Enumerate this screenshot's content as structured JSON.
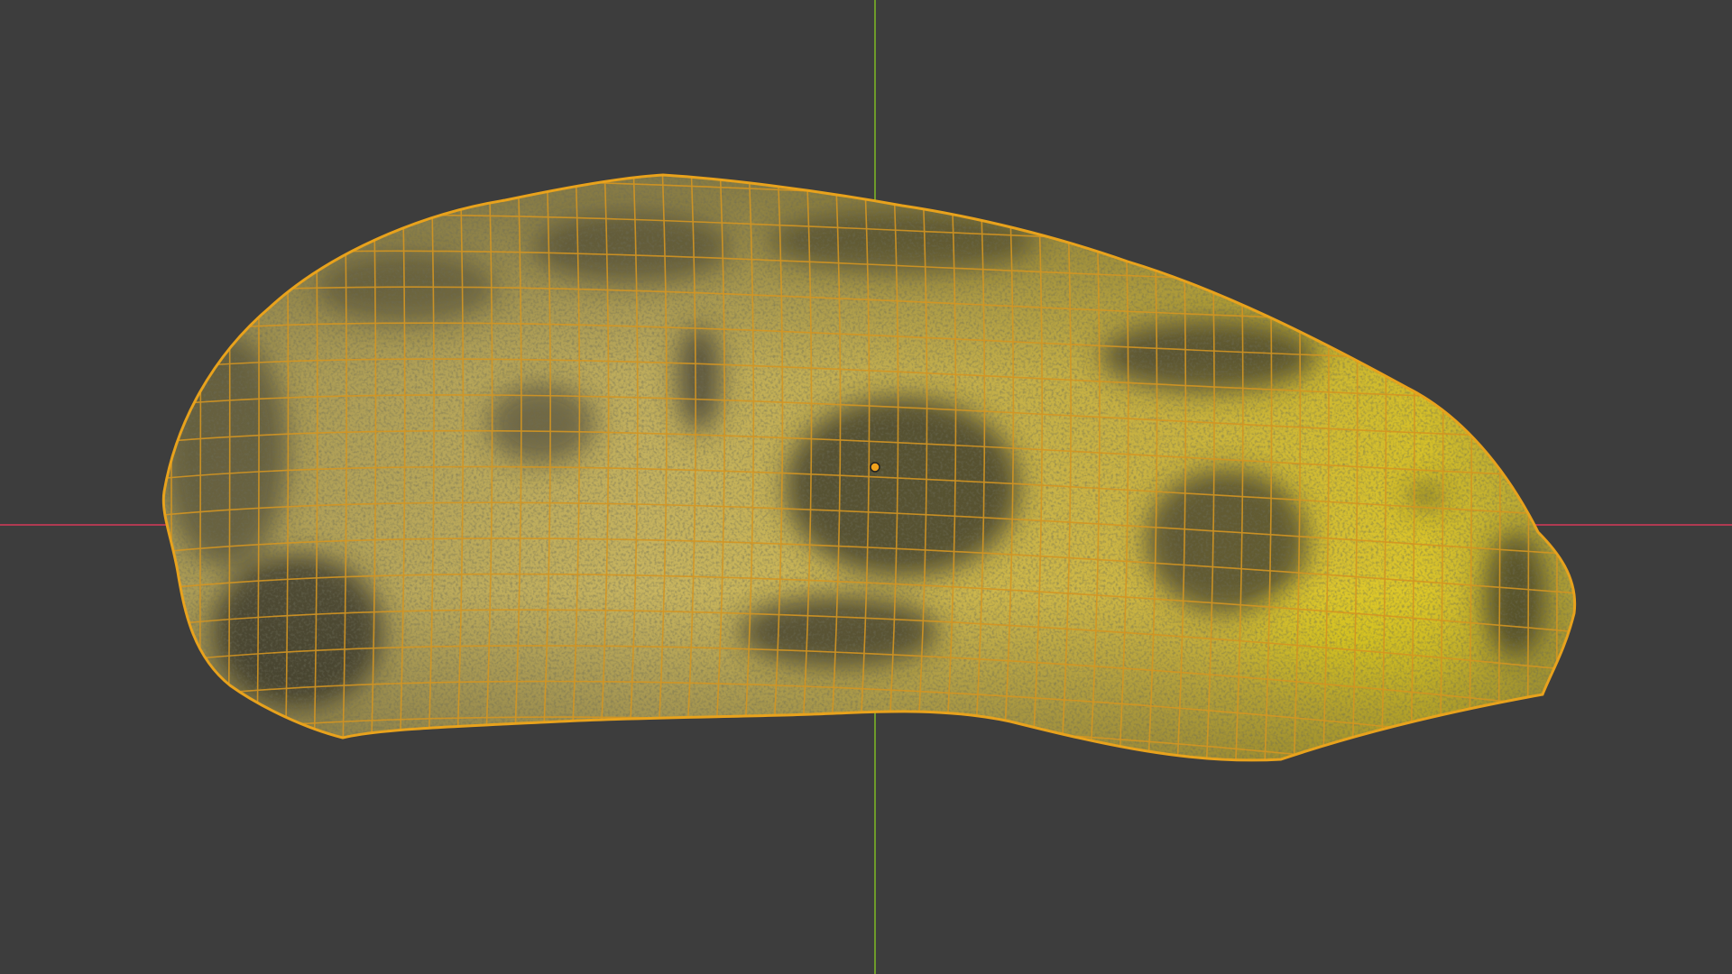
{
  "viewport": {
    "mode": "3d-viewport",
    "background_color": "#3d3d3d",
    "x_axis_color": "#b03a52",
    "y_axis_color": "#6e9a2a",
    "selection_outline_color": "#e8a21c",
    "wireframe_color": "#d49522"
  },
  "object": {
    "kind": "mesh",
    "subject": "banana",
    "selected": true,
    "display": "textured-with-wireframe-overlay",
    "texture_base_color": "#c9b24a",
    "texture_highlight_color": "#e2cc28",
    "texture_spot_color": "#3a3a30",
    "origin_dot_color": "#f0a21c"
  }
}
